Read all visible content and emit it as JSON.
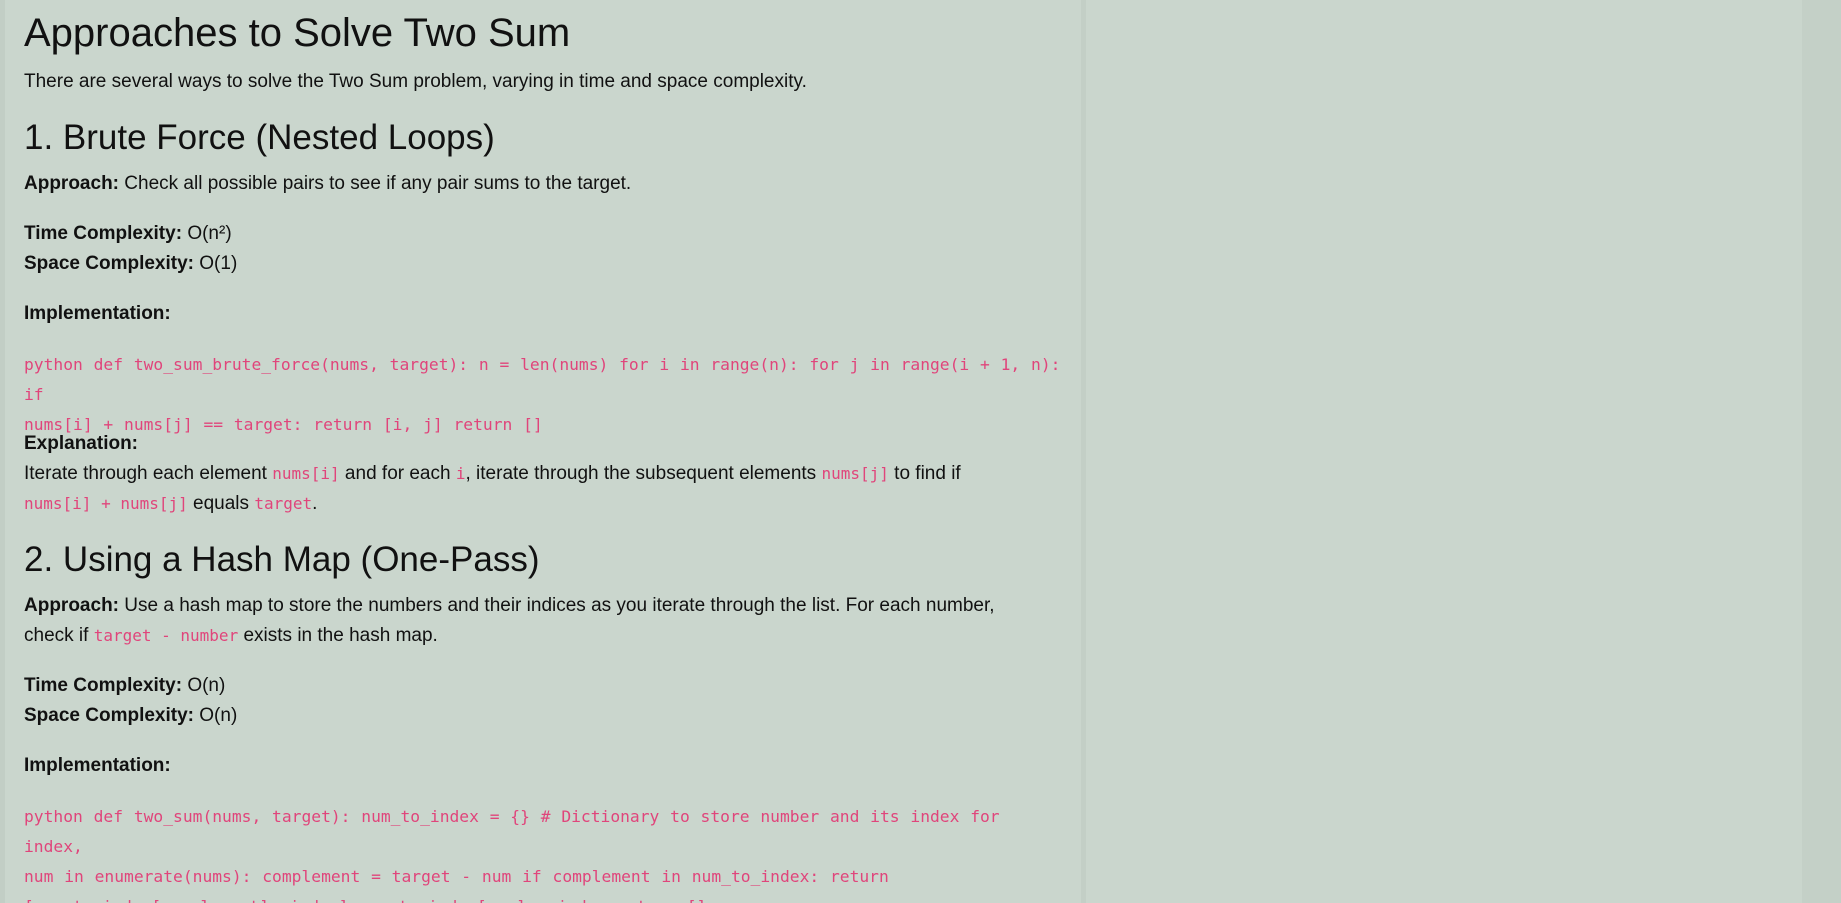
{
  "title": "Approaches to Solve Two Sum",
  "intro": "There are several ways to solve the Two Sum problem, varying in time and space complexity.",
  "sections": [
    {
      "title": "1. Brute Force (Nested Loops)",
      "approach_label": "Approach:",
      "approach_text": "Check all possible pairs to see if any pair sums to the target.",
      "time_label": "Time Complexity:",
      "time_value": "O(n²)",
      "space_label": "Space Complexity:",
      "space_value": "O(1)",
      "impl_label": "Implementation:",
      "code_line1": "python def two_sum_brute_force(nums, target): n = len(nums) for i in range(n): for j in range(i + 1, n): if",
      "code_line2": "nums[i] + nums[j] == target: return [i, j] return []",
      "explanation_label": "Explanation:",
      "exp_t1": "Iterate through each element ",
      "exp_c1": "nums[i]",
      "exp_t2": " and for each ",
      "exp_c2": "i",
      "exp_t3": ", iterate through the subsequent elements ",
      "exp_c3": "nums[j]",
      "exp_t4": " to find if",
      "exp_c4": "nums[i] + nums[j]",
      "exp_t5": " equals ",
      "exp_c5": "target",
      "exp_t6": "."
    },
    {
      "title": "2. Using a Hash Map (One-Pass)",
      "approach_label": "Approach:",
      "approach_line1": "Use a hash map to store the numbers and their indices as you iterate through the list. For each number,",
      "approach_t2": "check if ",
      "approach_c2": "target - number",
      "approach_t3": " exists in the hash map.",
      "time_label": "Time Complexity:",
      "time_value": "O(n)",
      "space_label": "Space Complexity:",
      "space_value": "O(n)",
      "impl_label": "Implementation:",
      "code_line1": "python def two_sum(nums, target): num_to_index = {} # Dictionary to store number and its index for index,",
      "code_line2": "num in enumerate(nums): complement = target - num if complement in num_to_index: return",
      "code_line3": "[num_to_index[complement], index] num_to_index[num] = index return []"
    }
  ]
}
